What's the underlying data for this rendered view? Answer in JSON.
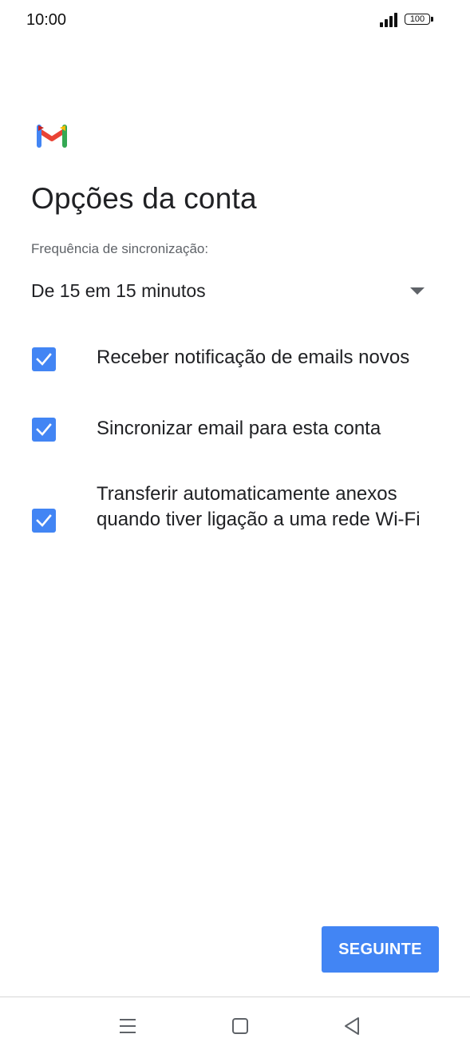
{
  "status_bar": {
    "time": "10:00",
    "battery_level": "100",
    "icons": [
      "signal-icon",
      "battery-icon"
    ]
  },
  "app": {
    "logo": "gmail-logo",
    "logo_colors": [
      "#4285f4",
      "#34a853",
      "#fbbc04",
      "#ea4335",
      "#c5221f"
    ]
  },
  "screen": {
    "title": "Opções da conta"
  },
  "sync": {
    "label": "Frequência de sincronização:",
    "selected_value": "De 15 em 15 minutos"
  },
  "options": [
    {
      "label": "Receber notificação de emails novos",
      "checked": true
    },
    {
      "label": "Sincronizar email para esta conta",
      "checked": true
    },
    {
      "label": "Transferir automaticamente anexos quando tiver ligação a uma rede Wi-Fi",
      "checked": true
    }
  ],
  "actions": {
    "next_label": "SEGUINTE"
  },
  "navigation": {
    "buttons": [
      "menu-icon",
      "home-icon",
      "back-icon"
    ]
  },
  "colors": {
    "accent": "#4285f4",
    "text_primary": "#202124",
    "text_secondary": "#5f6368"
  }
}
